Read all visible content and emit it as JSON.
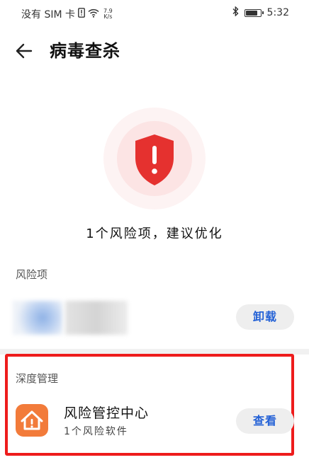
{
  "status_bar": {
    "carrier": "没有 SIM 卡",
    "net_speed_value": "7.9",
    "net_speed_unit": "K/s",
    "time": "5:32",
    "battery_level": 0.85
  },
  "header": {
    "title": "病毒查杀"
  },
  "summary": {
    "text": "1个风险项，建议优化"
  },
  "risk_section": {
    "label": "风险项",
    "action_label": "卸载"
  },
  "deep_section": {
    "label": "深度管理",
    "app_name": "风险管控中心",
    "app_sub": "1个风险软件",
    "action_label": "查看"
  },
  "colors": {
    "shield_red": "#e5312f",
    "accent_blue": "#2361d6",
    "highlight_red": "#ee1c1c",
    "app_icon_orange": "#f27b3a"
  }
}
